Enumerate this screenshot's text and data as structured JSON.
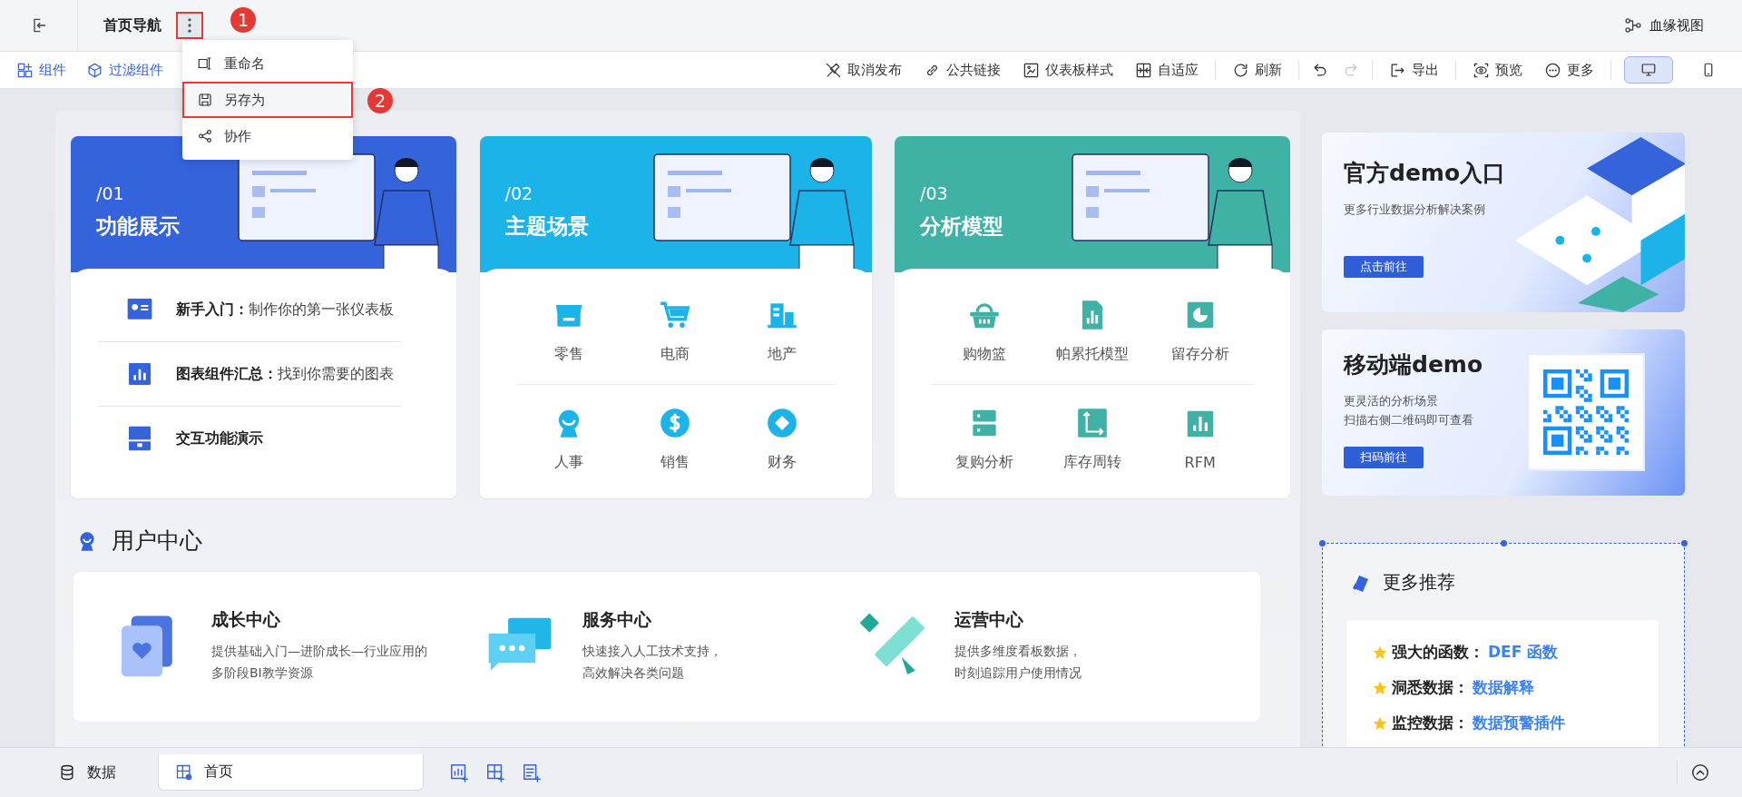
{
  "topbar": {
    "title": "首页导航",
    "menu_highlighted": true,
    "lineage": "血缘视图"
  },
  "callouts": [
    "1",
    "2"
  ],
  "menu": {
    "items": [
      {
        "label": "重命名",
        "highlighted": false
      },
      {
        "label": "另存为",
        "highlighted": true
      },
      {
        "label": "协作",
        "highlighted": false
      }
    ]
  },
  "toolbar": {
    "left": [
      {
        "label": "组件"
      },
      {
        "label": "过滤组件"
      }
    ],
    "actions": [
      {
        "label": "取消发布"
      },
      {
        "label": "公共链接"
      },
      {
        "label": "仪表板样式"
      },
      {
        "label": "自适应"
      }
    ],
    "refresh": "刷新",
    "history": [
      {
        "disabled": false
      },
      {
        "disabled": true
      }
    ],
    "export": "导出",
    "view": [
      {
        "label": "预览"
      },
      {
        "label": "更多"
      }
    ],
    "devices": [
      {
        "selected": true
      },
      {
        "selected": false
      }
    ]
  },
  "cards": [
    {
      "kind": "list",
      "number": "/01",
      "title": "功能展示",
      "color": "#3463dc",
      "items": [
        {
          "text": "**新手入门：**制作你的第一张仪表板"
        },
        {
          "text": "**图表组件汇总：**找到你需要的图表"
        },
        {
          "text": "**交互功能演示**"
        }
      ]
    },
    {
      "kind": "grid",
      "number": "/02",
      "title": "主题场景",
      "color": "#1cb4e8",
      "items": [
        {
          "label": "零售"
        },
        {
          "label": "电商"
        },
        {
          "label": "地产"
        },
        {
          "label": "人事"
        },
        {
          "label": "销售"
        },
        {
          "label": "财务"
        }
      ]
    },
    {
      "kind": "grid",
      "number": "/03",
      "title": "分析模型",
      "color": "#3fb2a5",
      "items": [
        {
          "label": "购物篮"
        },
        {
          "label": "帕累托模型"
        },
        {
          "label": "留存分析"
        },
        {
          "label": "复购分析"
        },
        {
          "label": "库存周转"
        },
        {
          "label": "RFM"
        }
      ]
    }
  ],
  "user_center": {
    "title": "用户中心",
    "items": [
      {
        "title": "成长中心",
        "desc": [
          "提供基础入门—进阶成长—行业应用的",
          "多阶段BI教学资源"
        ]
      },
      {
        "title": "服务中心",
        "desc": [
          "快速接入人工技术支持，",
          "高效解决各类问题"
        ]
      },
      {
        "title": "运营中心",
        "desc": [
          "提供多维度看板数据，",
          "时刻追踪用户使用情况"
        ]
      }
    ]
  },
  "demos": [
    {
      "title": "官方demo入口",
      "desc": [
        "更多行业数据分析解决案例"
      ],
      "button": "点击前往"
    },
    {
      "title": "移动端demo",
      "desc": [
        "更灵活的分析场景",
        "扫描右侧二维码即可查看"
      ],
      "button": "扫码前往"
    }
  ],
  "recommend": {
    "title": "更多推荐",
    "items": [
      {
        "label": "强大的函数：",
        "link": "DEF 函数"
      },
      {
        "label": "洞悉数据：",
        "link": "数据解释"
      },
      {
        "label": "监控数据：",
        "link": "数据预警插件"
      }
    ]
  },
  "bottom": {
    "data_tab": "数据",
    "page_tab": "首页"
  }
}
